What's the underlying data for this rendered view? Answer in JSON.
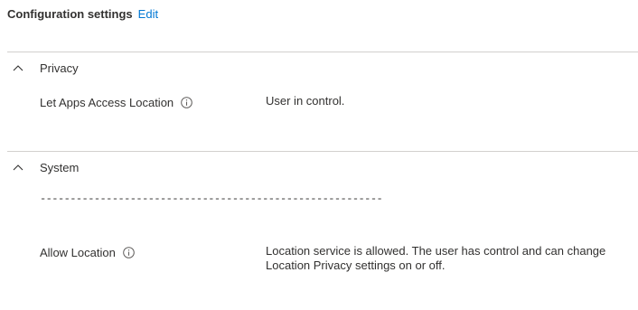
{
  "header": {
    "title": "Configuration settings",
    "edit_label": "Edit"
  },
  "sections": [
    {
      "title": "Privacy",
      "icon": "chevron-up-icon",
      "settings": [
        {
          "label": "Let Apps Access Location",
          "value": "User in control."
        }
      ]
    },
    {
      "title": "System",
      "icon": "chevron-up-icon",
      "separator_text": "----------------------------------------------------------------------",
      "settings": [
        {
          "label": "Allow Location",
          "value": "Location service is allowed. The user has control and can change Location Privacy settings on or off."
        }
      ]
    }
  ],
  "colors": {
    "link": "#0078d4",
    "text": "#323130",
    "divider": "#d2d0ce"
  }
}
